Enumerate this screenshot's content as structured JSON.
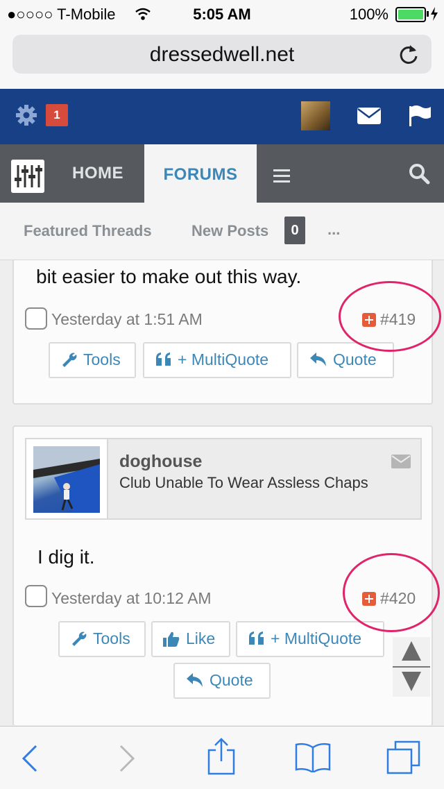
{
  "status_bar": {
    "carrier": "●○○○○ T-Mobile",
    "time": "5:05 AM",
    "battery": "100%",
    "battery_level": 1.0
  },
  "browser": {
    "url": "dressedwell.net"
  },
  "header": {
    "notification_count": "1"
  },
  "nav": {
    "home": "HOME",
    "forums": "FORUMS"
  },
  "subnav": {
    "featured": "Featured Threads",
    "new_posts": "New Posts",
    "new_posts_count": "0",
    "more": "..."
  },
  "posts": [
    {
      "text": "bit easier to make out this way.",
      "date": "Yesterday at 1:51 AM",
      "number": "#419",
      "buttons": [
        "Tools",
        "+ MultiQuote",
        "Quote"
      ]
    },
    {
      "username": "doghouse",
      "user_title": "Club Unable To Wear Assless Chaps",
      "text": "I dig it.",
      "date": "Yesterday at 10:12 AM",
      "number": "#420",
      "buttons": [
        "Tools",
        "Like",
        "+ MultiQuote",
        "Quote"
      ]
    }
  ],
  "colors": {
    "header_blue": "#174087",
    "nav_gray": "#565a5e",
    "link_blue": "#3d87b7",
    "highlight_circle": "#e0246a",
    "badge_red": "#d74b3d"
  },
  "icons": {
    "status": [
      "wifi-icon",
      "battery-icon",
      "charging-icon"
    ],
    "browser": [
      "reload-icon"
    ],
    "header": [
      "gear-icon",
      "avatar",
      "mail-icon",
      "flag-icon"
    ],
    "nav": [
      "logo-icon",
      "menu-icon",
      "search-icon"
    ],
    "toolbar": [
      "back-icon",
      "forward-icon",
      "share-icon",
      "bookmarks-icon",
      "tabs-icon"
    ]
  }
}
